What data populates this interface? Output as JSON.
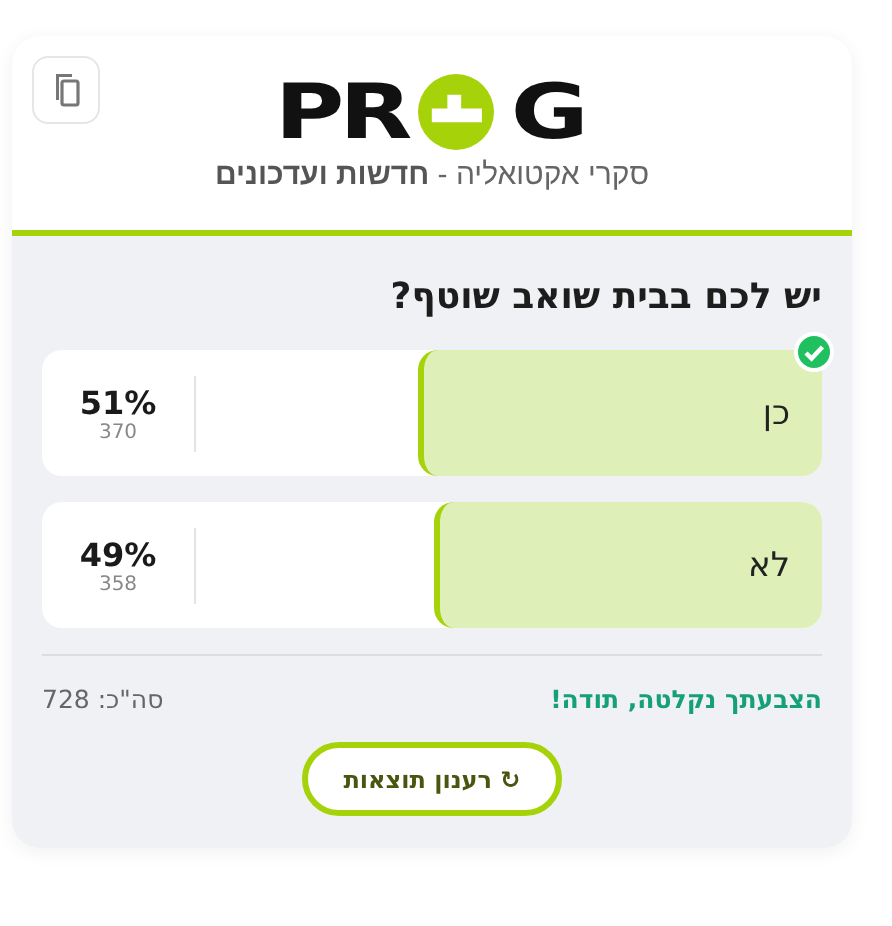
{
  "logo": {
    "left": "PR",
    "right": "G",
    "tagline": "סקרי אקטואליה - **חדשות ועדכונים**"
  },
  "poll": {
    "question": "יש לכם בבית שואב שוטף?",
    "options": [
      {
        "label": "כן",
        "percent": "51%",
        "votes": "370",
        "level": 0.51,
        "selected": true
      },
      {
        "label": "לא",
        "percent": "49%",
        "votes": "358",
        "level": 0.49,
        "selected": false
      }
    ]
  },
  "footer": {
    "message": "הצבעתך נקלטה, תודה!",
    "total": "סה\"כ: 728"
  },
  "refresh_button": "↻ רענון תוצאות"
}
